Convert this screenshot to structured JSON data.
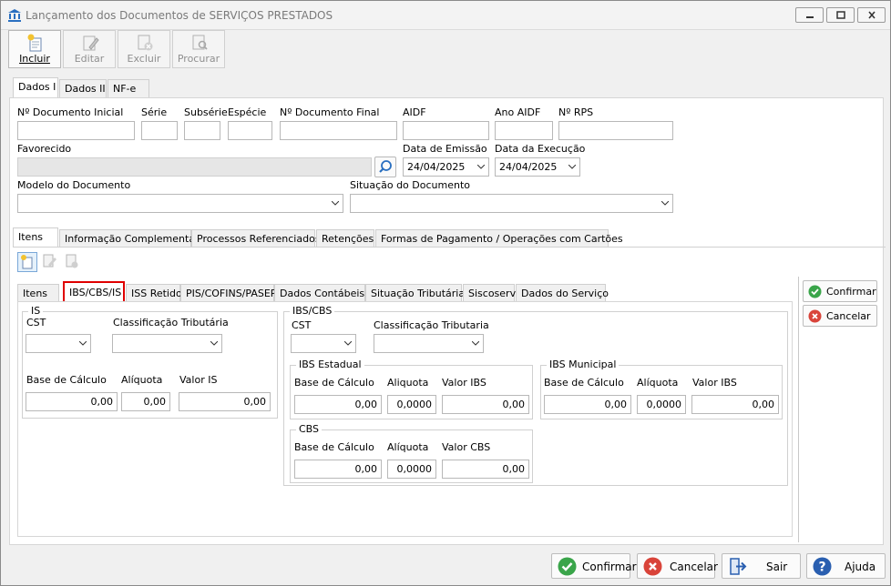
{
  "window": {
    "title": "Lançamento dos Documentos de SERVIÇOS PRESTADOS"
  },
  "toolbar": {
    "incluir": "Incluir",
    "editar": "Editar",
    "excluir": "Excluir",
    "procurar": "Procurar"
  },
  "main_tabs": [
    "Dados I",
    "Dados II",
    "NF-e"
  ],
  "form": {
    "doc_inicial_label": "Nº Documento Inicial",
    "serie_label": "Série",
    "subserie_label": "Subsérie",
    "especie_label": "Espécie",
    "doc_final_label": "Nº Documento Final",
    "aidf_label": "AIDF",
    "ano_aidf_label": "Ano AIDF",
    "rps_label": "Nº RPS",
    "favorecido_label": "Favorecido",
    "data_emissao_label": "Data de Emissão",
    "data_emissao_value": "24/04/2025",
    "data_execucao_label": "Data da Execução",
    "data_execucao_value": "24/04/2025",
    "modelo_label": "Modelo do Documento",
    "situacao_label": "Situação do Documento"
  },
  "section_tabs": [
    "Itens",
    "Informação Complementar",
    "Processos Referenciados",
    "Retenções",
    "Formas de Pagamento / Operações com Cartões"
  ],
  "item_tabs": [
    "Itens",
    "IBS/CBS/IS",
    "ISS Retido",
    "PIS/COFINS/PASEP",
    "Dados Contábeis",
    "Situação Tributária",
    "Siscoserv",
    "Dados do Serviço"
  ],
  "is_group": {
    "title": "IS",
    "cst_label": "CST",
    "class_label": "Classificação Tributária",
    "base_label": "Base de Cálculo",
    "aliq_label": "Alíquota",
    "valor_label": "Valor IS",
    "base_value": "0,00",
    "aliq_value": "0,00",
    "valor_value": "0,00"
  },
  "ibs_cbs_group": {
    "title": "IBS/CBS",
    "cst_label": "CST",
    "class_label": "Classificação Tributaria"
  },
  "ibs_estadual": {
    "title": "IBS Estadual",
    "base_label": "Base de Cálculo",
    "aliq_label": "Aliquota",
    "valor_label": "Valor IBS",
    "base_value": "0,00",
    "aliq_value": "0,0000",
    "valor_value": "0,00"
  },
  "ibs_municipal": {
    "title": "IBS Municipal",
    "base_label": "Base de Cálculo",
    "aliq_label": "Alíquota",
    "valor_label": "Valor IBS",
    "base_value": "0,00",
    "aliq_value": "0,0000",
    "valor_value": "0,00"
  },
  "cbs": {
    "title": "CBS",
    "base_label": "Base de Cálculo",
    "aliq_label": "Alíquota",
    "valor_label": "Valor CBS",
    "base_value": "0,00",
    "aliq_value": "0,0000",
    "valor_value": "0,00"
  },
  "side_buttons": {
    "confirmar": "Confirmar",
    "cancelar": "Cancelar"
  },
  "bottom_buttons": {
    "confirmar": "Confirmar",
    "cancelar": "Cancelar",
    "sair": "Sair",
    "ajuda": "Ajuda"
  },
  "colors": {
    "highlight": "#e00000",
    "confirm_green": "#3aa54a",
    "cancel_red": "#d9443a",
    "help_blue": "#2a5fb0"
  }
}
